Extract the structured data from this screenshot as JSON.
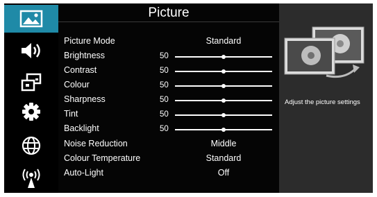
{
  "menu": {
    "title": "Picture",
    "items": [
      {
        "label": "Picture Mode",
        "type": "text",
        "value": "Standard"
      },
      {
        "label": "Brightness",
        "type": "slider",
        "value": "50",
        "level": 0.5
      },
      {
        "label": "Contrast",
        "type": "slider",
        "value": "50",
        "level": 0.5
      },
      {
        "label": "Colour",
        "type": "slider",
        "value": "50",
        "level": 0.5
      },
      {
        "label": "Sharpness",
        "type": "slider",
        "value": "50",
        "level": 0.5
      },
      {
        "label": "Tint",
        "type": "slider",
        "value": "50",
        "level": 0.5
      },
      {
        "label": "Backlight",
        "type": "slider",
        "value": "50",
        "level": 0.5
      },
      {
        "label": "Noise Reduction",
        "type": "text",
        "value": "Middle"
      },
      {
        "label": "Colour Temperature",
        "type": "text",
        "value": "Standard"
      },
      {
        "label": "Auto-Light",
        "type": "text",
        "value": "Off"
      }
    ]
  },
  "sidebar": {
    "icons": [
      "picture-icon",
      "sound-icon",
      "source-icon",
      "settings-icon",
      "network-icon",
      "wireless-icon"
    ],
    "active_index": 0
  },
  "info": {
    "description": "Adjust the picture settings"
  },
  "colors": {
    "accent": "#1f8aa7",
    "background": "#000000",
    "info_panel": "#2c2c2c"
  }
}
